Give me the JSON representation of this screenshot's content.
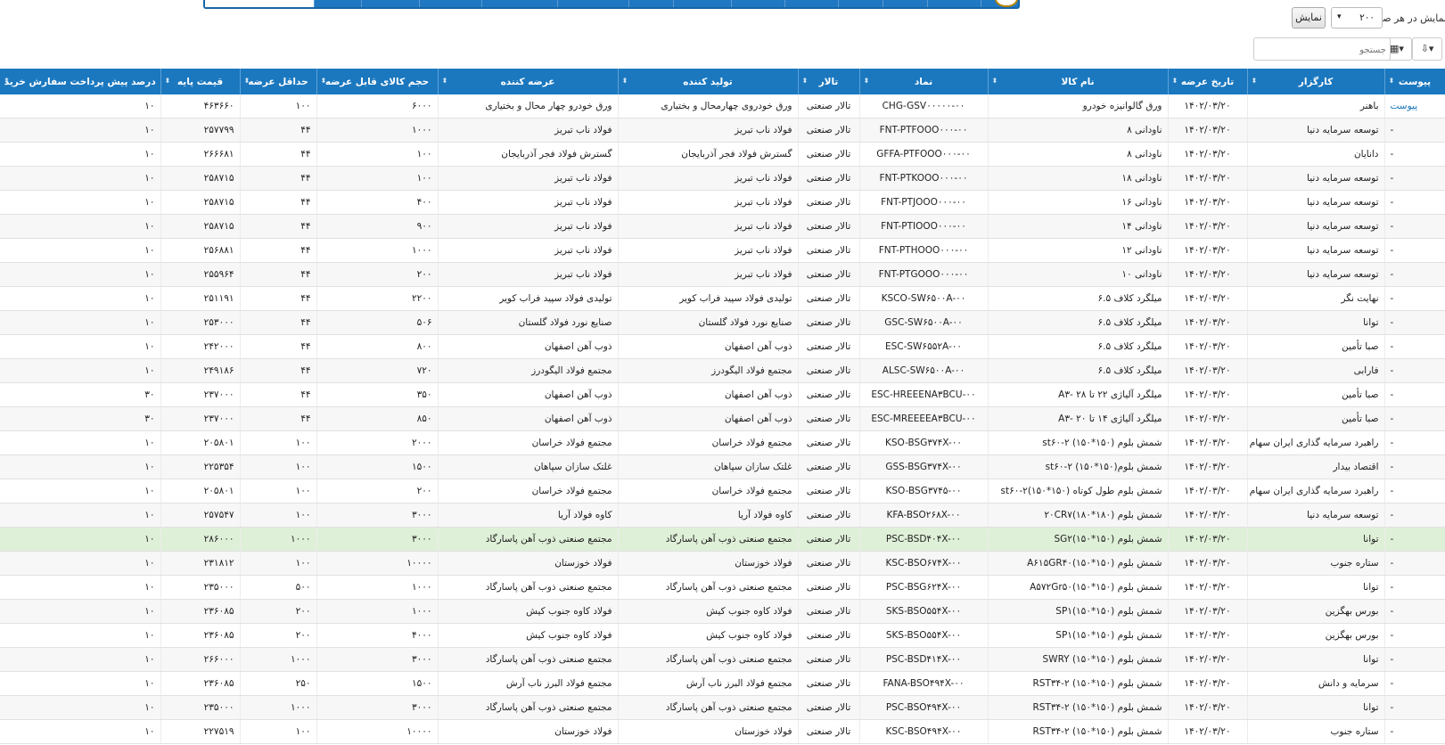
{
  "controls": {
    "per_page_label": "نمایش در هر صفحه",
    "per_page_value": "۲۰۰",
    "show_button": "نمایش",
    "search_placeholder": "جستجو",
    "chevron_glyph": "▾"
  },
  "columns": [
    "پیوست",
    "کارگزار",
    "تاریخ عرضه",
    "نام کالا",
    "نماد",
    "تالار",
    "تولید کننده",
    "عرضه کننده",
    "حجم کالای قابل عرضه",
    "حداقل عرضه",
    "قیمت پایه",
    "درصد پیش پرداخت سفارش خرید"
  ],
  "rows": [
    [
      "پیوست",
      "باهنر",
      "۱۴۰۲/۰۳/۲۰",
      "ورق گالوانیزه خودرو",
      "CHG-GSV۰۰۰۰۰-۰۰",
      "تالار صنعتی",
      "ورق خودروی چهارمحال و بختیاری",
      "ورق خودرو چهار محال و بختیاری",
      "۶۰۰۰",
      "۱۰۰",
      "۴۶۳۶۶۰",
      "۱۰"
    ],
    [
      "-",
      "توسعه سرمایه دنیا",
      "۱۴۰۲/۰۳/۲۰",
      "ناودانی ۸",
      "FNT-PTFOOO۰۰۰-۰۰",
      "تالار صنعتی",
      "فولاد ناب تبریز",
      "فولاد ناب تبریز",
      "۱۰۰۰",
      "۴۴",
      "۲۵۷۷۹۹",
      "۱۰"
    ],
    [
      "-",
      "دانایان",
      "۱۴۰۲/۰۳/۲۰",
      "ناودانی ۸",
      "GFFA-PTFOOO۰۰۰-۰۰",
      "تالار صنعتی",
      "گسترش فولاد فجر آذربایجان",
      "گسترش فولاد فجر آذربایجان",
      "۱۰۰",
      "۴۴",
      "۲۶۶۶۸۱",
      "۱۰"
    ],
    [
      "-",
      "توسعه سرمایه دنیا",
      "۱۴۰۲/۰۳/۲۰",
      "ناودانی ۱۸",
      "FNT-PTKOOO۰۰۰-۰۰",
      "تالار صنعتی",
      "فولاد ناب تبریز",
      "فولاد ناب تبریز",
      "۱۰۰",
      "۴۴",
      "۲۵۸۷۱۵",
      "۱۰"
    ],
    [
      "-",
      "توسعه سرمایه دنیا",
      "۱۴۰۲/۰۳/۲۰",
      "ناودانی ۱۶",
      "FNT-PTJOOO۰۰۰-۰۰",
      "تالار صنعتی",
      "فولاد ناب تبریز",
      "فولاد ناب تبریز",
      "۴۰۰",
      "۴۴",
      "۲۵۸۷۱۵",
      "۱۰"
    ],
    [
      "-",
      "توسعه سرمایه دنیا",
      "۱۴۰۲/۰۳/۲۰",
      "ناودانی ۱۴",
      "FNT-PTIOOO۰۰۰-۰۰",
      "تالار صنعتی",
      "فولاد ناب تبریز",
      "فولاد ناب تبریز",
      "۹۰۰",
      "۴۴",
      "۲۵۸۷۱۵",
      "۱۰"
    ],
    [
      "-",
      "توسعه سرمایه دنیا",
      "۱۴۰۲/۰۳/۲۰",
      "ناودانی ۱۲",
      "FNT-PTHOOO۰۰۰-۰۰",
      "تالار صنعتی",
      "فولاد ناب تبریز",
      "فولاد ناب تبریز",
      "۱۰۰۰",
      "۴۴",
      "۲۵۶۸۸۱",
      "۱۰"
    ],
    [
      "-",
      "توسعه سرمایه دنیا",
      "۱۴۰۲/۰۳/۲۰",
      "ناودانی ۱۰",
      "FNT-PTGOOO۰۰۰-۰۰",
      "تالار صنعتی",
      "فولاد ناب تبریز",
      "فولاد ناب تبریز",
      "۲۰۰",
      "۴۴",
      "۲۵۵۹۶۴",
      "۱۰"
    ],
    [
      "-",
      "نهایت نگر",
      "۱۴۰۲/۰۳/۲۰",
      "میلگرد کلاف ۶.۵",
      "KSCO-SW۶۵۰۰A-۰۰",
      "تالار صنعتی",
      "تولیدی فولاد سپید فراب کویر",
      "تولیدی فولاد سپید فراب کویر",
      "۲۲۰۰",
      "۴۴",
      "۲۵۱۱۹۱",
      "۱۰"
    ],
    [
      "-",
      "توانا",
      "۱۴۰۲/۰۳/۲۰",
      "میلگرد کلاف ۶.۵",
      "GSC-SW۶۵۰۰A-۰۰",
      "تالار صنعتی",
      "صنایع نورد فولاد گلستان",
      "صنایع نورد فولاد گلستان",
      "۵۰۶",
      "۴۴",
      "۲۵۳۰۰۰",
      "۱۰"
    ],
    [
      "-",
      "صبا تأمین",
      "۱۴۰۲/۰۳/۲۰",
      "میلگرد کلاف ۶.۵",
      "ESC-SW۶۵۵۲A-۰۰",
      "تالار صنعتی",
      "ذوب آهن اصفهان",
      "ذوب آهن اصفهان",
      "۸۰۰",
      "۴۴",
      "۲۴۲۰۰۰",
      "۱۰"
    ],
    [
      "-",
      "فارابی",
      "۱۴۰۲/۰۳/۲۰",
      "میلگرد کلاف ۶.۵",
      "ALSC-SW۶۵۰۰A-۰۰",
      "تالار صنعتی",
      "مجتمع فولاد الیگودرز",
      "مجتمع فولاد الیگودرز",
      "۷۲۰",
      "۴۴",
      "۲۴۹۱۸۶",
      "۱۰"
    ],
    [
      "-",
      "صبا تأمین",
      "۱۴۰۲/۰۳/۲۰",
      "میلگرد آلیاژی ۲۲ تا ۲۸ -A۳",
      "ESC-HREEENA۳BCU-۰۰",
      "تالار صنعتی",
      "ذوب آهن اصفهان",
      "ذوب آهن اصفهان",
      "۳۵۰",
      "۴۴",
      "۲۳۷۰۰۰",
      "۳۰"
    ],
    [
      "-",
      "صبا تأمین",
      "۱۴۰۲/۰۳/۲۰",
      "میلگرد آلیاژی ۱۴ تا ۲۰ -A۳",
      "ESC-MREEEEA۳BCU-۰۰",
      "تالار صنعتی",
      "ذوب آهن اصفهان",
      "ذوب آهن اصفهان",
      "۸۵۰",
      "۴۴",
      "۲۳۷۰۰۰",
      "۳۰"
    ],
    [
      "-",
      "راهبرد سرمایه گذاری ایران سهام",
      "۱۴۰۲/۰۳/۲۰",
      "شمش بلوم (۱۵۰*۱۵۰) ۲-st۶۰",
      "KSO-BSG۳۷۴X-۰۰",
      "تالار صنعتی",
      "مجتمع فولاد خراسان",
      "مجتمع فولاد خراسان",
      "۲۰۰۰",
      "۱۰۰",
      "۲۰۵۸۰۱",
      "۱۰"
    ],
    [
      "-",
      "اقتصاد بیدار",
      "۱۴۰۲/۰۳/۲۰",
      "شمش بلوم(۱۵۰*۱۵۰) ۲-st۶۰",
      "GSS-BSG۳۷۴X-۰۰",
      "تالار صنعتی",
      "غلتک سازان سپاهان",
      "غلتک سازان سپاهان",
      "۱۵۰۰",
      "۱۰۰",
      "۲۲۵۳۵۴",
      "۱۰"
    ],
    [
      "-",
      "راهبرد سرمایه گذاری ایران سهام",
      "۱۴۰۲/۰۳/۲۰",
      "شمش بلوم طول کوتاه (۱۵۰*۱۵۰)۲-st۶۰",
      "KSO-BSG۳۷۴۵-۰۰",
      "تالار صنعتی",
      "مجتمع فولاد خراسان",
      "مجتمع فولاد خراسان",
      "۲۰۰",
      "۱۰۰",
      "۲۰۵۸۰۱",
      "۱۰"
    ],
    [
      "-",
      "توسعه سرمایه دنیا",
      "۱۴۰۲/۰۳/۲۰",
      "شمش بلوم (۱۸۰*۱۸۰)۲۰CR۷",
      "KFA-BSO۲۶۸X-۰۰",
      "تالار صنعتی",
      "کاوه فولاد آریا",
      "کاوه فولاد آریا",
      "۳۰۰۰",
      "۱۰۰",
      "۲۵۷۵۴۷",
      "۱۰"
    ],
    [
      "-",
      "توانا",
      "۱۴۰۲/۰۳/۲۰",
      "شمش بلوم (۱۵۰*۱۵۰)SG۲",
      "PSC-BSD۴۰۴X-۰۰",
      "تالار صنعتی",
      "مجتمع صنعتی ذوب آهن پاسارگاد",
      "مجتمع صنعتی ذوب آهن پاسارگاد",
      "۳۰۰۰",
      "۱۰۰۰",
      "۲۸۶۰۰۰",
      "۱۰"
    ],
    [
      "-",
      "ستاره جنوب",
      "۱۴۰۲/۰۳/۲۰",
      "شمش بلوم (۱۵۰*۱۵۰)A۶۱۵GR۴۰",
      "KSC-BSO۶۷۴X-۰۰",
      "تالار صنعتی",
      "فولاد خوزستان",
      "فولاد خوزستان",
      "۱۰۰۰۰",
      "۱۰۰",
      "۲۳۱۸۱۲",
      "۱۰"
    ],
    [
      "-",
      "توانا",
      "۱۴۰۲/۰۳/۲۰",
      "شمش بلوم (۱۵۰*۱۵۰)A۵۷۲Gr۵۰",
      "PSC-BSG۶۲۴X-۰۰",
      "تالار صنعتی",
      "مجتمع صنعتی ذوب آهن پاسارگاد",
      "مجتمع صنعتی ذوب آهن پاسارگاد",
      "۱۰۰۰",
      "۵۰۰",
      "۲۳۵۰۰۰",
      "۱۰"
    ],
    [
      "-",
      "بورس بهگزین",
      "۱۴۰۲/۰۳/۲۰",
      "شمش بلوم (۱۵۰*۱۵۰)SP۱",
      "SKS-BSO۵۵۴X-۰۰",
      "تالار صنعتی",
      "فولاد کاوه جنوب کیش",
      "فولاد کاوه جنوب کیش",
      "۱۰۰۰",
      "۲۰۰",
      "۲۳۶۰۸۵",
      "۱۰"
    ],
    [
      "-",
      "بورس بهگزین",
      "۱۴۰۲/۰۳/۲۰",
      "شمش بلوم (۱۵۰*۱۵۰)SP۱",
      "SKS-BSO۵۵۴X-۰۰",
      "تالار صنعتی",
      "فولاد کاوه جنوب کیش",
      "فولاد کاوه جنوب کیش",
      "۴۰۰۰",
      "۲۰۰",
      "۲۳۶۰۸۵",
      "۱۰"
    ],
    [
      "-",
      "توانا",
      "۱۴۰۲/۰۳/۲۰",
      "شمش بلوم (۱۵۰*۱۵۰) SWRY",
      "PSC-BSD۴۱۴X-۰۰",
      "تالار صنعتی",
      "مجتمع صنعتی ذوب آهن پاسارگاد",
      "مجتمع صنعتی ذوب آهن پاسارگاد",
      "۳۰۰۰",
      "۱۰۰۰",
      "۲۶۶۰۰۰",
      "۱۰"
    ],
    [
      "-",
      "سرمایه و دانش",
      "۱۴۰۲/۰۳/۲۰",
      "شمش بلوم (۱۵۰*۱۵۰) ۲-RST۳۴",
      "FANA-BSO۴۹۴X-۰۰",
      "تالار صنعتی",
      "مجتمع فولاد البرز ناب آرش",
      "مجتمع فولاد البرز ناب آرش",
      "۱۵۰۰",
      "۲۵۰",
      "۲۳۶۰۸۵",
      "۱۰"
    ],
    [
      "-",
      "توانا",
      "۱۴۰۲/۰۳/۲۰",
      "شمش بلوم (۱۵۰*۱۵۰) ۲-RST۳۴",
      "PSC-BSO۴۹۴X-۰۰",
      "تالار صنعتی",
      "مجتمع صنعتی ذوب آهن پاسارگاد",
      "مجتمع صنعتی ذوب آهن پاسارگاد",
      "۳۰۰۰",
      "۱۰۰۰",
      "۲۳۵۰۰۰",
      "۱۰"
    ],
    [
      "-",
      "ستاره جنوب",
      "۱۴۰۲/۰۳/۲۰",
      "شمش بلوم (۱۵۰*۱۵۰) ۲-RST۳۴",
      "KSC-BSO۴۹۴X-۰۰",
      "تالار صنعتی",
      "فولاد خوزستان",
      "فولاد خوزستان",
      "۱۰۰۰۰",
      "۱۰۰",
      "۲۲۷۵۱۹",
      "۱۰"
    ]
  ],
  "highlight_row_index": 18
}
